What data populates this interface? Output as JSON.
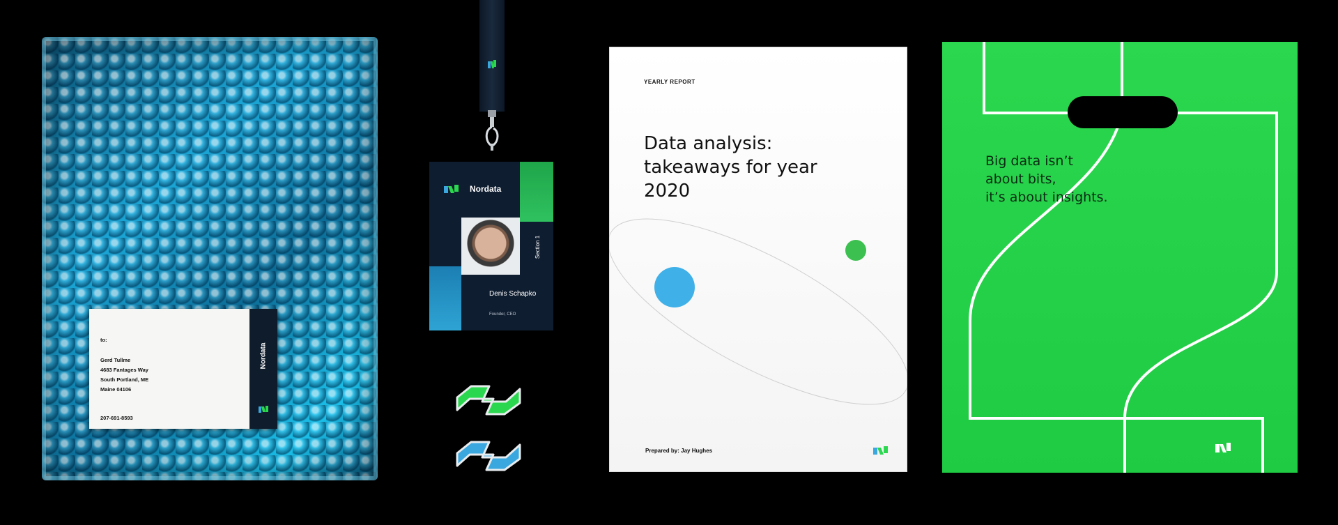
{
  "mailer": {
    "label_to": "to:",
    "recipient_name": "Gerd Tullme",
    "street": "4683  Fantages Way",
    "city": "South Portland, ME",
    "state_zip": "Maine 04106",
    "phone": "207-691-8593",
    "brand": "Nordata"
  },
  "badge": {
    "brand": "Nordata",
    "section": "Section 1",
    "name": "Denis Schapko",
    "role": "Founder, CEO"
  },
  "report": {
    "label": "YEARLY REPORT",
    "title": "Data analysis: takeaways for year 2020",
    "author": "Prepared by: Jay Hughes"
  },
  "bag": {
    "text": "Big data isn’t\nabout bits,\nit’s about insights."
  },
  "colors": {
    "green": "#2bd74e",
    "blue": "#3aa8de",
    "navy": "#0f1d30"
  }
}
